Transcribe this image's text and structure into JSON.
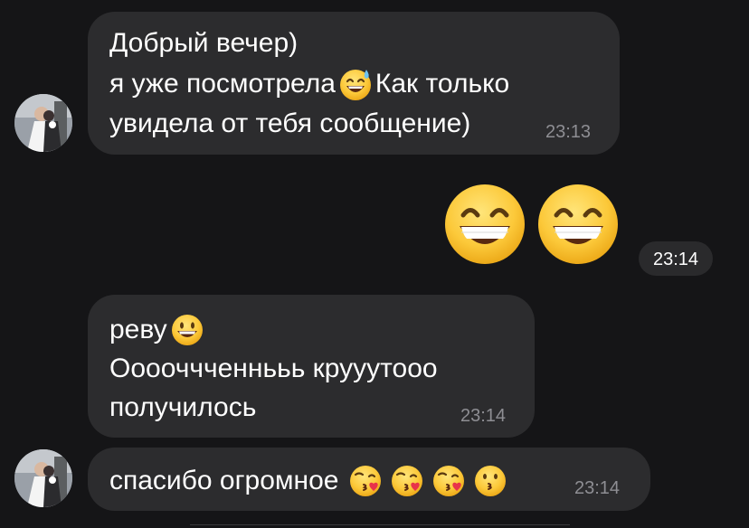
{
  "messages": [
    {
      "lines": [
        "Добрый вечер)",
        "я уже посмотрела",
        "Как только",
        "увидела от тебя сообщение)"
      ],
      "time": "23:13",
      "emoji": [
        "sweat-smile-emoji"
      ]
    },
    {
      "time": "23:14",
      "emoji": [
        "grinning-emoji",
        "grinning-emoji"
      ]
    },
    {
      "lines": [
        "реву",
        "Ооооччченнььь крууутооо",
        "получилось"
      ],
      "time": "23:14",
      "emoji": [
        "smiley-emoji"
      ]
    },
    {
      "lines": [
        "спасибо огромное"
      ],
      "time": "23:14",
      "emoji": [
        "kissing-heart-emoji",
        "kissing-heart-emoji",
        "kissing-heart-emoji",
        "kissing-emoji"
      ]
    }
  ],
  "colors": {
    "background": "#151517",
    "bubble": "#2c2c2e",
    "text": "#ffffff",
    "timestamp": "#8e8e93",
    "emoji_yellow": "#f7c536"
  }
}
